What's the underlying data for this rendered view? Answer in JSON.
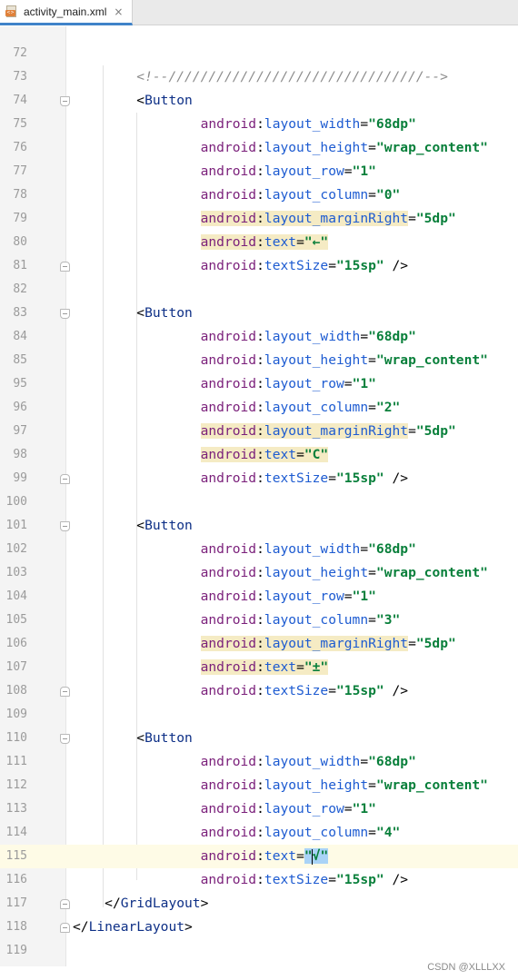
{
  "tab": {
    "filename": "activity_main.xml",
    "close_glyph": "×",
    "file_badge": "<>"
  },
  "lines": [
    {
      "num": "72",
      "fold": null,
      "tokens": []
    },
    {
      "num": "73",
      "fold": null,
      "indent": "    ",
      "tokens": [
        {
          "t": "comment",
          "v": "<!--////////////////////////////////-->"
        }
      ]
    },
    {
      "num": "74",
      "fold": "open",
      "indent": "    ",
      "tokens": [
        {
          "t": "punct",
          "v": "<"
        },
        {
          "t": "tag",
          "v": "Button"
        }
      ]
    },
    {
      "num": "75",
      "fold": null,
      "indent": "        ",
      "tokens": [
        {
          "t": "ns",
          "v": "android"
        },
        {
          "t": "punct",
          "v": ":"
        },
        {
          "t": "attr",
          "v": "layout_width"
        },
        {
          "t": "punct",
          "v": "="
        },
        {
          "t": "val",
          "v": "\"68dp\""
        }
      ]
    },
    {
      "num": "76",
      "fold": null,
      "indent": "        ",
      "tokens": [
        {
          "t": "ns",
          "v": "android"
        },
        {
          "t": "punct",
          "v": ":"
        },
        {
          "t": "attr",
          "v": "layout_height"
        },
        {
          "t": "punct",
          "v": "="
        },
        {
          "t": "val",
          "v": "\"wrap_content\""
        }
      ]
    },
    {
      "num": "77",
      "fold": null,
      "indent": "        ",
      "tokens": [
        {
          "t": "ns",
          "v": "android"
        },
        {
          "t": "punct",
          "v": ":"
        },
        {
          "t": "attr",
          "v": "layout_row"
        },
        {
          "t": "punct",
          "v": "="
        },
        {
          "t": "val",
          "v": "\"1\""
        }
      ]
    },
    {
      "num": "78",
      "fold": null,
      "indent": "        ",
      "tokens": [
        {
          "t": "ns",
          "v": "android"
        },
        {
          "t": "punct",
          "v": ":"
        },
        {
          "t": "attr",
          "v": "layout_column"
        },
        {
          "t": "punct",
          "v": "="
        },
        {
          "t": "val",
          "v": "\"0\""
        }
      ]
    },
    {
      "num": "79",
      "fold": null,
      "indent": "        ",
      "tokens": [
        {
          "t": "ns",
          "v": "android",
          "hl": true
        },
        {
          "t": "punct",
          "v": ":",
          "hl": true
        },
        {
          "t": "attr",
          "v": "layout_marginRight",
          "hl": true
        },
        {
          "t": "punct",
          "v": "="
        },
        {
          "t": "val",
          "v": "\"5dp\""
        }
      ]
    },
    {
      "num": "80",
      "fold": null,
      "indent": "        ",
      "tokens": [
        {
          "t": "ns",
          "v": "android",
          "hl": true
        },
        {
          "t": "punct",
          "v": ":",
          "hl": true
        },
        {
          "t": "attr",
          "v": "text",
          "hl": true
        },
        {
          "t": "punct",
          "v": "=",
          "hl": true
        },
        {
          "t": "val",
          "v": "\"←\"",
          "hl": true
        }
      ]
    },
    {
      "num": "81",
      "fold": "close",
      "indent": "        ",
      "tokens": [
        {
          "t": "ns",
          "v": "android"
        },
        {
          "t": "punct",
          "v": ":"
        },
        {
          "t": "attr",
          "v": "textSize"
        },
        {
          "t": "punct",
          "v": "="
        },
        {
          "t": "val",
          "v": "\"15sp\""
        },
        {
          "t": "punct",
          "v": " />"
        }
      ]
    },
    {
      "num": "82",
      "fold": null,
      "tokens": []
    },
    {
      "num": "83",
      "fold": "open",
      "indent": "    ",
      "tokens": [
        {
          "t": "punct",
          "v": "<"
        },
        {
          "t": "tag",
          "v": "Button"
        }
      ]
    },
    {
      "num": "84",
      "fold": null,
      "indent": "        ",
      "tokens": [
        {
          "t": "ns",
          "v": "android"
        },
        {
          "t": "punct",
          "v": ":"
        },
        {
          "t": "attr",
          "v": "layout_width"
        },
        {
          "t": "punct",
          "v": "="
        },
        {
          "t": "val",
          "v": "\"68dp\""
        }
      ]
    },
    {
      "num": "85",
      "fold": null,
      "indent": "        ",
      "tokens": [
        {
          "t": "ns",
          "v": "android"
        },
        {
          "t": "punct",
          "v": ":"
        },
        {
          "t": "attr",
          "v": "layout_height"
        },
        {
          "t": "punct",
          "v": "="
        },
        {
          "t": "val",
          "v": "\"wrap_content\""
        }
      ]
    },
    {
      "num": "95",
      "fold": null,
      "indent": "        ",
      "tokens": [
        {
          "t": "ns",
          "v": "android"
        },
        {
          "t": "punct",
          "v": ":"
        },
        {
          "t": "attr",
          "v": "layout_row"
        },
        {
          "t": "punct",
          "v": "="
        },
        {
          "t": "val",
          "v": "\"1\""
        }
      ]
    },
    {
      "num": "96",
      "fold": null,
      "indent": "        ",
      "tokens": [
        {
          "t": "ns",
          "v": "android"
        },
        {
          "t": "punct",
          "v": ":"
        },
        {
          "t": "attr",
          "v": "layout_column"
        },
        {
          "t": "punct",
          "v": "="
        },
        {
          "t": "val",
          "v": "\"2\""
        }
      ]
    },
    {
      "num": "97",
      "fold": null,
      "indent": "        ",
      "tokens": [
        {
          "t": "ns",
          "v": "android",
          "hl": true
        },
        {
          "t": "punct",
          "v": ":",
          "hl": true
        },
        {
          "t": "attr",
          "v": "layout_marginRight",
          "hl": true
        },
        {
          "t": "punct",
          "v": "="
        },
        {
          "t": "val",
          "v": "\"5dp\""
        }
      ]
    },
    {
      "num": "98",
      "fold": null,
      "indent": "        ",
      "tokens": [
        {
          "t": "ns",
          "v": "android",
          "hl": true
        },
        {
          "t": "punct",
          "v": ":",
          "hl": true
        },
        {
          "t": "attr",
          "v": "text",
          "hl": true
        },
        {
          "t": "punct",
          "v": "=",
          "hl": true
        },
        {
          "t": "val",
          "v": "\"C\"",
          "hl": true
        }
      ]
    },
    {
      "num": "99",
      "fold": "close",
      "indent": "        ",
      "tokens": [
        {
          "t": "ns",
          "v": "android"
        },
        {
          "t": "punct",
          "v": ":"
        },
        {
          "t": "attr",
          "v": "textSize"
        },
        {
          "t": "punct",
          "v": "="
        },
        {
          "t": "val",
          "v": "\"15sp\""
        },
        {
          "t": "punct",
          "v": " />"
        }
      ]
    },
    {
      "num": "100",
      "fold": null,
      "tokens": []
    },
    {
      "num": "101",
      "fold": "open",
      "indent": "    ",
      "tokens": [
        {
          "t": "punct",
          "v": "<"
        },
        {
          "t": "tag",
          "v": "Button"
        }
      ]
    },
    {
      "num": "102",
      "fold": null,
      "indent": "        ",
      "tokens": [
        {
          "t": "ns",
          "v": "android"
        },
        {
          "t": "punct",
          "v": ":"
        },
        {
          "t": "attr",
          "v": "layout_width"
        },
        {
          "t": "punct",
          "v": "="
        },
        {
          "t": "val",
          "v": "\"68dp\""
        }
      ]
    },
    {
      "num": "103",
      "fold": null,
      "indent": "        ",
      "tokens": [
        {
          "t": "ns",
          "v": "android"
        },
        {
          "t": "punct",
          "v": ":"
        },
        {
          "t": "attr",
          "v": "layout_height"
        },
        {
          "t": "punct",
          "v": "="
        },
        {
          "t": "val",
          "v": "\"wrap_content\""
        }
      ]
    },
    {
      "num": "104",
      "fold": null,
      "indent": "        ",
      "tokens": [
        {
          "t": "ns",
          "v": "android"
        },
        {
          "t": "punct",
          "v": ":"
        },
        {
          "t": "attr",
          "v": "layout_row"
        },
        {
          "t": "punct",
          "v": "="
        },
        {
          "t": "val",
          "v": "\"1\""
        }
      ]
    },
    {
      "num": "105",
      "fold": null,
      "indent": "        ",
      "tokens": [
        {
          "t": "ns",
          "v": "android"
        },
        {
          "t": "punct",
          "v": ":"
        },
        {
          "t": "attr",
          "v": "layout_column"
        },
        {
          "t": "punct",
          "v": "="
        },
        {
          "t": "val",
          "v": "\"3\""
        }
      ]
    },
    {
      "num": "106",
      "fold": null,
      "indent": "        ",
      "tokens": [
        {
          "t": "ns",
          "v": "android",
          "hl": true
        },
        {
          "t": "punct",
          "v": ":",
          "hl": true
        },
        {
          "t": "attr",
          "v": "layout_marginRight",
          "hl": true
        },
        {
          "t": "punct",
          "v": "="
        },
        {
          "t": "val",
          "v": "\"5dp\""
        }
      ]
    },
    {
      "num": "107",
      "fold": null,
      "indent": "        ",
      "tokens": [
        {
          "t": "ns",
          "v": "android",
          "hl": true
        },
        {
          "t": "punct",
          "v": ":",
          "hl": true
        },
        {
          "t": "attr",
          "v": "text",
          "hl": true
        },
        {
          "t": "punct",
          "v": "=",
          "hl": true
        },
        {
          "t": "val",
          "v": "\"±\"",
          "hl": true
        }
      ]
    },
    {
      "num": "108",
      "fold": "close",
      "indent": "        ",
      "tokens": [
        {
          "t": "ns",
          "v": "android"
        },
        {
          "t": "punct",
          "v": ":"
        },
        {
          "t": "attr",
          "v": "textSize"
        },
        {
          "t": "punct",
          "v": "="
        },
        {
          "t": "val",
          "v": "\"15sp\""
        },
        {
          "t": "punct",
          "v": " />"
        }
      ]
    },
    {
      "num": "109",
      "fold": null,
      "tokens": []
    },
    {
      "num": "110",
      "fold": "open",
      "indent": "    ",
      "tokens": [
        {
          "t": "punct",
          "v": "<"
        },
        {
          "t": "tag",
          "v": "Button"
        }
      ]
    },
    {
      "num": "111",
      "fold": null,
      "indent": "        ",
      "tokens": [
        {
          "t": "ns",
          "v": "android"
        },
        {
          "t": "punct",
          "v": ":"
        },
        {
          "t": "attr",
          "v": "layout_width"
        },
        {
          "t": "punct",
          "v": "="
        },
        {
          "t": "val",
          "v": "\"68dp\""
        }
      ]
    },
    {
      "num": "112",
      "fold": null,
      "indent": "        ",
      "tokens": [
        {
          "t": "ns",
          "v": "android"
        },
        {
          "t": "punct",
          "v": ":"
        },
        {
          "t": "attr",
          "v": "layout_height"
        },
        {
          "t": "punct",
          "v": "="
        },
        {
          "t": "val",
          "v": "\"wrap_content\""
        }
      ]
    },
    {
      "num": "113",
      "fold": null,
      "indent": "        ",
      "tokens": [
        {
          "t": "ns",
          "v": "android"
        },
        {
          "t": "punct",
          "v": ":"
        },
        {
          "t": "attr",
          "v": "layout_row"
        },
        {
          "t": "punct",
          "v": "="
        },
        {
          "t": "val",
          "v": "\"1\""
        }
      ]
    },
    {
      "num": "114",
      "fold": null,
      "indent": "        ",
      "tokens": [
        {
          "t": "ns",
          "v": "android"
        },
        {
          "t": "punct",
          "v": ":"
        },
        {
          "t": "attr",
          "v": "layout_column"
        },
        {
          "t": "punct",
          "v": "="
        },
        {
          "t": "val",
          "v": "\"4\""
        }
      ]
    },
    {
      "num": "115",
      "fold": null,
      "current": true,
      "indent": "        ",
      "tokens": [
        {
          "t": "ns",
          "v": "android"
        },
        {
          "t": "punct",
          "v": ":"
        },
        {
          "t": "attr",
          "v": "text"
        },
        {
          "t": "punct",
          "v": "="
        },
        {
          "t": "val",
          "v": "\"",
          "sel": true
        },
        {
          "t": "caret",
          "v": ""
        },
        {
          "t": "val",
          "v": "√\"",
          "sel": true
        }
      ]
    },
    {
      "num": "116",
      "fold": null,
      "indent": "        ",
      "tokens": [
        {
          "t": "ns",
          "v": "android"
        },
        {
          "t": "punct",
          "v": ":"
        },
        {
          "t": "attr",
          "v": "textSize"
        },
        {
          "t": "punct",
          "v": "="
        },
        {
          "t": "val",
          "v": "\"15sp\""
        },
        {
          "t": "punct",
          "v": " />"
        }
      ]
    },
    {
      "num": "117",
      "fold": "close",
      "indent": "  ",
      "tokens": [
        {
          "t": "punct",
          "v": "</"
        },
        {
          "t": "tag",
          "v": "GridLayout"
        },
        {
          "t": "punct",
          "v": ">"
        }
      ]
    },
    {
      "num": "118",
      "fold": "close",
      "indent": "",
      "tokens": [
        {
          "t": "punct",
          "v": "</"
        },
        {
          "t": "tag",
          "v": "LinearLayout"
        },
        {
          "t": "punct",
          "v": ">"
        }
      ]
    },
    {
      "num": "119",
      "fold": null,
      "tokens": []
    }
  ],
  "watermark": "CSDN @XLLLXX",
  "colors": {
    "comment": "#8c8c8c",
    "tag": "#0d2f86",
    "namespace": "#7a1f7a",
    "attribute": "#1d5bd1",
    "value": "#087f3a",
    "highlight": "#f5ebc4",
    "selection": "#a9d3f7",
    "current_line": "#fefbe6",
    "tab_underline": "#4083c9"
  }
}
